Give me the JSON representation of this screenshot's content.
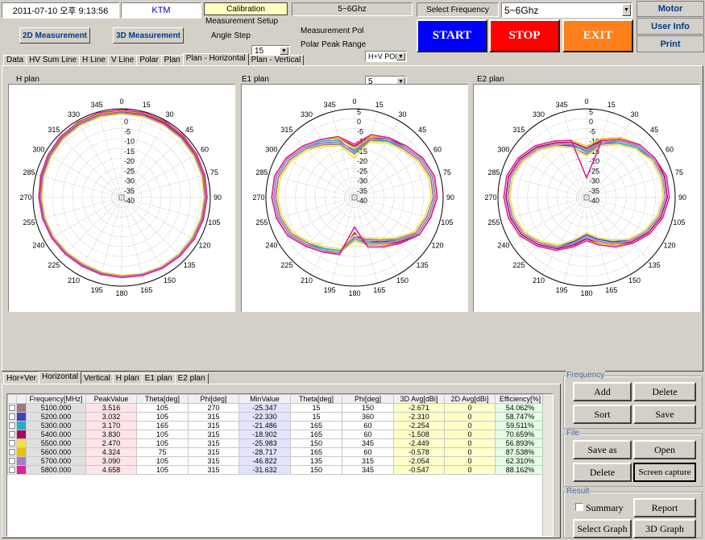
{
  "header": {
    "datetime": "2011-07-10 오후 9:13:56",
    "org": "KTM",
    "calibration_label": "Calibration",
    "band_label": "5~6Ghz",
    "select_freq_label": "Select Frequency",
    "select_freq_value": "5~6Ghz",
    "motor_label": "Motor",
    "userinfo_label": "User Info",
    "print_label": "Print",
    "mode_2d": "2D Measurement",
    "mode_3d": "3D Measurement",
    "meas_setup_label": "Measurement  Setup",
    "angle_step_label": "Angle Step",
    "angle_step_value": "15",
    "meas_pol_label": "Measurement Pol",
    "meas_pol_value": "H+V POL",
    "polar_peak_label": "Polar Peak Range",
    "polar_peak_value": "5",
    "start_label": "START",
    "stop_label": "STOP",
    "exit_label": "EXIT"
  },
  "colors": {
    "start": "#0000ff",
    "stop": "#ff0000",
    "exit": "#ff7f1a",
    "highlight": "#ffffc0"
  },
  "tabs": [
    "Data",
    "HV Sum Line",
    "H Line",
    "V Line",
    "Polar",
    "Plan",
    "Plan - Horizontal",
    "Plan - Vertical"
  ],
  "active_tab": 6,
  "plots": [
    {
      "title": "H plan"
    },
    {
      "title": "E1 plan"
    },
    {
      "title": "E2 plan"
    }
  ],
  "polar": {
    "angle_labels": [
      "0",
      "15",
      "30",
      "45",
      "60",
      "75",
      "90",
      "105",
      "120",
      "135",
      "150",
      "165",
      "180",
      "195",
      "210",
      "225",
      "240",
      "255",
      "270",
      "285",
      "300",
      "315",
      "330",
      "345"
    ],
    "radial_labels": [
      "5",
      "0",
      "-5",
      "-10",
      "-15",
      "-20",
      "-25",
      "-30",
      "-35",
      "-40"
    ],
    "rmax": 5,
    "rmin": -40
  },
  "series_colors": [
    "#a07878",
    "#4040c0",
    "#20b0c0",
    "#b00060",
    "#f0e040",
    "#f0c000",
    "#a080c0",
    "#e020a0"
  ],
  "chart_data": [
    {
      "type": "line",
      "title": "H plan",
      "angles_deg": [
        0,
        15,
        30,
        45,
        60,
        75,
        90,
        105,
        120,
        135,
        150,
        165,
        180,
        195,
        210,
        225,
        240,
        255,
        270,
        285,
        300,
        315,
        330,
        345
      ],
      "series": [
        {
          "values": [
            2.5,
            2.6,
            2.8,
            2.7,
            2.9,
            2.6,
            2.3,
            2.0,
            1.5,
            1.2,
            0.8,
            0.2,
            -0.2,
            -0.8,
            -1.0,
            -0.6,
            0.0,
            0.5,
            0.8,
            1.0,
            1.5,
            2.0,
            2.3,
            2.4
          ]
        },
        {
          "values": [
            3.0,
            3.0,
            3.0,
            3.0,
            3.0,
            2.8,
            2.6,
            2.2,
            1.8,
            1.5,
            1.0,
            0.5,
            0.0,
            -0.3,
            -0.5,
            -0.2,
            0.3,
            0.8,
            1.2,
            1.5,
            2.0,
            2.5,
            2.8,
            3.0
          ]
        },
        {
          "values": [
            3.1,
            3.1,
            3.1,
            3.0,
            3.0,
            2.9,
            2.7,
            2.3,
            2.0,
            1.6,
            1.2,
            0.6,
            0.2,
            0.0,
            -0.3,
            0.0,
            0.5,
            1.0,
            1.3,
            1.6,
            2.2,
            2.7,
            3.0,
            3.1
          ]
        },
        {
          "values": [
            3.8,
            3.8,
            3.7,
            3.6,
            3.4,
            3.2,
            3.0,
            2.6,
            2.2,
            1.8,
            1.4,
            0.8,
            0.5,
            0.3,
            0.0,
            0.3,
            0.8,
            1.3,
            1.8,
            2.2,
            2.8,
            3.3,
            3.6,
            3.8
          ]
        },
        {
          "values": [
            2.4,
            2.4,
            2.5,
            2.3,
            2.2,
            2.0,
            1.8,
            1.5,
            1.0,
            0.8,
            0.5,
            0.0,
            -0.5,
            -0.8,
            -1.2,
            -0.8,
            -0.2,
            0.3,
            0.6,
            1.0,
            1.5,
            2.0,
            2.2,
            2.4
          ]
        },
        {
          "values": [
            4.0,
            4.2,
            4.3,
            4.1,
            3.8,
            3.5,
            3.2,
            2.8,
            2.3,
            1.9,
            1.4,
            0.9,
            0.6,
            0.4,
            0.2,
            0.5,
            1.0,
            1.5,
            2.0,
            2.5,
            3.0,
            3.5,
            3.8,
            4.0
          ]
        },
        {
          "values": [
            3.0,
            3.0,
            2.9,
            2.8,
            2.8,
            2.6,
            2.4,
            2.0,
            1.6,
            1.3,
            0.9,
            0.4,
            0.0,
            -0.3,
            -0.6,
            -0.2,
            0.4,
            0.8,
            1.2,
            1.5,
            2.0,
            2.5,
            2.8,
            3.0
          ]
        },
        {
          "values": [
            4.5,
            4.6,
            4.5,
            4.3,
            4.0,
            3.7,
            3.4,
            3.0,
            2.5,
            2.0,
            1.5,
            1.0,
            0.7,
            0.5,
            0.3,
            0.6,
            1.1,
            1.6,
            2.1,
            2.6,
            3.2,
            3.8,
            4.2,
            4.5
          ]
        }
      ]
    },
    {
      "type": "line",
      "title": "E1 plan",
      "angles_deg": [
        0,
        15,
        30,
        45,
        60,
        75,
        90,
        105,
        120,
        135,
        150,
        165,
        180,
        195,
        210,
        225,
        240,
        255,
        270,
        285,
        300,
        315,
        330,
        345
      ],
      "series": [
        {
          "values": [
            -18,
            -10,
            -7,
            -5,
            -2,
            0,
            0,
            -2,
            -4,
            -10,
            -15,
            -18,
            -20,
            -12,
            -10,
            -7,
            -3,
            -1,
            0,
            0,
            -2,
            -5,
            -9,
            -12
          ]
        },
        {
          "values": [
            -16,
            -9,
            -6,
            -4,
            -1,
            1,
            1,
            -1,
            -3,
            -9,
            -14,
            -17,
            -20,
            -11,
            -9,
            -6,
            -2,
            0,
            1,
            1,
            -1,
            -4,
            -8,
            -11
          ]
        },
        {
          "values": [
            -17,
            -9,
            -7,
            -4,
            -1,
            1,
            1,
            -1,
            -3,
            -9,
            -13,
            -16,
            -19,
            -12,
            -10,
            -6,
            -2,
            0,
            1,
            1,
            -1,
            -4,
            -7,
            -10
          ]
        },
        {
          "values": [
            -14,
            -8,
            -6,
            -3,
            0,
            2,
            2,
            0,
            -2,
            -8,
            -12,
            -15,
            -22,
            -10,
            -8,
            -5,
            -1,
            1,
            2,
            2,
            0,
            -3,
            -6,
            -9
          ]
        },
        {
          "values": [
            -20,
            -11,
            -8,
            -6,
            -3,
            -1,
            -1,
            -3,
            -5,
            -11,
            -16,
            -19,
            -21,
            -13,
            -11,
            -8,
            -4,
            -2,
            -1,
            -1,
            -3,
            -6,
            -10,
            -13
          ]
        },
        {
          "values": [
            -15,
            -8,
            -5,
            -3,
            0,
            2,
            2,
            0,
            -2,
            -7,
            -12,
            -15,
            -18,
            -11,
            -8,
            -5,
            -1,
            1,
            2,
            2,
            0,
            -3,
            -6,
            -9
          ]
        },
        {
          "values": [
            -16,
            -9,
            -6,
            -4,
            -1,
            1,
            1,
            -1,
            -3,
            -9,
            -13,
            -17,
            -20,
            -11,
            -9,
            -6,
            -2,
            0,
            1,
            1,
            -1,
            -4,
            -8,
            -11
          ]
        },
        {
          "values": [
            -13,
            -7,
            -5,
            -3,
            0,
            2,
            2,
            0,
            -2,
            -7,
            -11,
            -14,
            -25,
            -10,
            -8,
            -5,
            -1,
            1,
            2,
            2,
            0,
            -3,
            -6,
            -8
          ]
        }
      ]
    },
    {
      "type": "line",
      "title": "E2 plan",
      "angles_deg": [
        0,
        15,
        30,
        45,
        60,
        75,
        90,
        105,
        120,
        135,
        150,
        165,
        180,
        195,
        210,
        225,
        240,
        255,
        270,
        285,
        300,
        315,
        330,
        345
      ],
      "series": [
        {
          "values": [
            -18,
            -12,
            -8,
            -4,
            -2,
            -1,
            -1,
            -3,
            -6,
            -10,
            -15,
            -19,
            -22,
            -18,
            -12,
            -8,
            -4,
            -2,
            -1,
            -1,
            -3,
            -6,
            -10,
            -14
          ]
        },
        {
          "values": [
            -16,
            -11,
            -7,
            -3,
            -1,
            0,
            0,
            -2,
            -5,
            -9,
            -14,
            -18,
            -21,
            -17,
            -11,
            -7,
            -3,
            -1,
            0,
            0,
            -2,
            -5,
            -9,
            -13
          ]
        },
        {
          "values": [
            -17,
            -11,
            -8,
            -4,
            -1,
            0,
            0,
            -2,
            -5,
            -9,
            -13,
            -17,
            -20,
            -16,
            -11,
            -7,
            -3,
            -1,
            0,
            0,
            -2,
            -5,
            -9,
            -12
          ]
        },
        {
          "values": [
            -15,
            -10,
            -6,
            -2,
            0,
            1,
            1,
            -1,
            -4,
            -8,
            -12,
            -16,
            -19,
            -15,
            -10,
            -6,
            -2,
            0,
            1,
            1,
            -1,
            -4,
            -8,
            -11
          ]
        },
        {
          "values": [
            -19,
            -13,
            -9,
            -5,
            -2,
            -1,
            -1,
            -3,
            -6,
            -10,
            -15,
            -19,
            -22,
            -18,
            -12,
            -8,
            -4,
            -2,
            -1,
            -1,
            -3,
            -6,
            -10,
            -14
          ]
        },
        {
          "values": [
            -14,
            -9,
            -5,
            -2,
            0,
            2,
            2,
            0,
            -3,
            -7,
            -12,
            -16,
            -18,
            -14,
            -9,
            -5,
            -1,
            1,
            2,
            2,
            0,
            -3,
            -7,
            -10
          ]
        },
        {
          "values": [
            -16,
            -11,
            -7,
            -3,
            -1,
            0,
            0,
            -2,
            -5,
            -9,
            -13,
            -17,
            -20,
            -16,
            -11,
            -7,
            -3,
            -1,
            0,
            0,
            -2,
            -5,
            -9,
            -12
          ]
        },
        {
          "values": [
            -30,
            -10,
            -6,
            -2,
            0,
            2,
            2,
            0,
            -3,
            -7,
            -11,
            -15,
            -18,
            -14,
            -9,
            -5,
            -1,
            1,
            2,
            2,
            0,
            -3,
            -7,
            -10
          ]
        }
      ]
    }
  ],
  "bottom_tabs": [
    "Hor+Ver",
    "Horizontal",
    "Vertical",
    "H plan",
    "E1 plan",
    "E2 plan"
  ],
  "bottom_active_tab": 1,
  "table": {
    "headers": [
      "Frequency[MHz]",
      "PeakValue",
      "Theta[deg]",
      "Phi[deg]",
      "MinValue",
      "Theta[deg]",
      "Phi[deg]",
      "3D Avg[dBi]",
      "2D Avg[dBi]",
      "Efficiency[%]"
    ],
    "rows": [
      [
        "5100.000",
        "3.516",
        "105",
        "270",
        "-25.347",
        "15",
        "150",
        "-2.671",
        "0",
        "54.062%"
      ],
      [
        "5200.000",
        "3.032",
        "105",
        "315",
        "-22.330",
        "15",
        "360",
        "-2.310",
        "0",
        "58.747%"
      ],
      [
        "5300.000",
        "3.170",
        "165",
        "315",
        "-21.486",
        "165",
        "60",
        "-2.254",
        "0",
        "59.511%"
      ],
      [
        "5400.000",
        "3.830",
        "105",
        "315",
        "-18.902",
        "165",
        "60",
        "-1.508",
        "0",
        "70.659%"
      ],
      [
        "5500.000",
        "2.470",
        "105",
        "315",
        "-25.983",
        "150",
        "345",
        "-2.449",
        "0",
        "56.893%"
      ],
      [
        "5600.000",
        "4.324",
        "75",
        "315",
        "-28.717",
        "165",
        "60",
        "-0.578",
        "0",
        "87.538%"
      ],
      [
        "5700.000",
        "3.090",
        "105",
        "315",
        "-46.822",
        "135",
        "315",
        "-2.054",
        "0",
        "62.310%"
      ],
      [
        "5800.000",
        "4.658",
        "105",
        "315",
        "-31.632",
        "150",
        "345",
        "-0.547",
        "0",
        "88.162%"
      ]
    ]
  },
  "frequency_group": {
    "label": "Frequency",
    "add": "Add",
    "delete": "Delete",
    "sort": "Sort",
    "save": "Save"
  },
  "file_group": {
    "label": "File",
    "save_as": "Save as",
    "open": "Open",
    "delete": "Delete",
    "screen_capture": "Screen capture"
  },
  "result_group": {
    "label": "Result",
    "summary": "Summary",
    "report": "Report",
    "select_graph": "Select Graph",
    "graph_3d": "3D Graph"
  }
}
